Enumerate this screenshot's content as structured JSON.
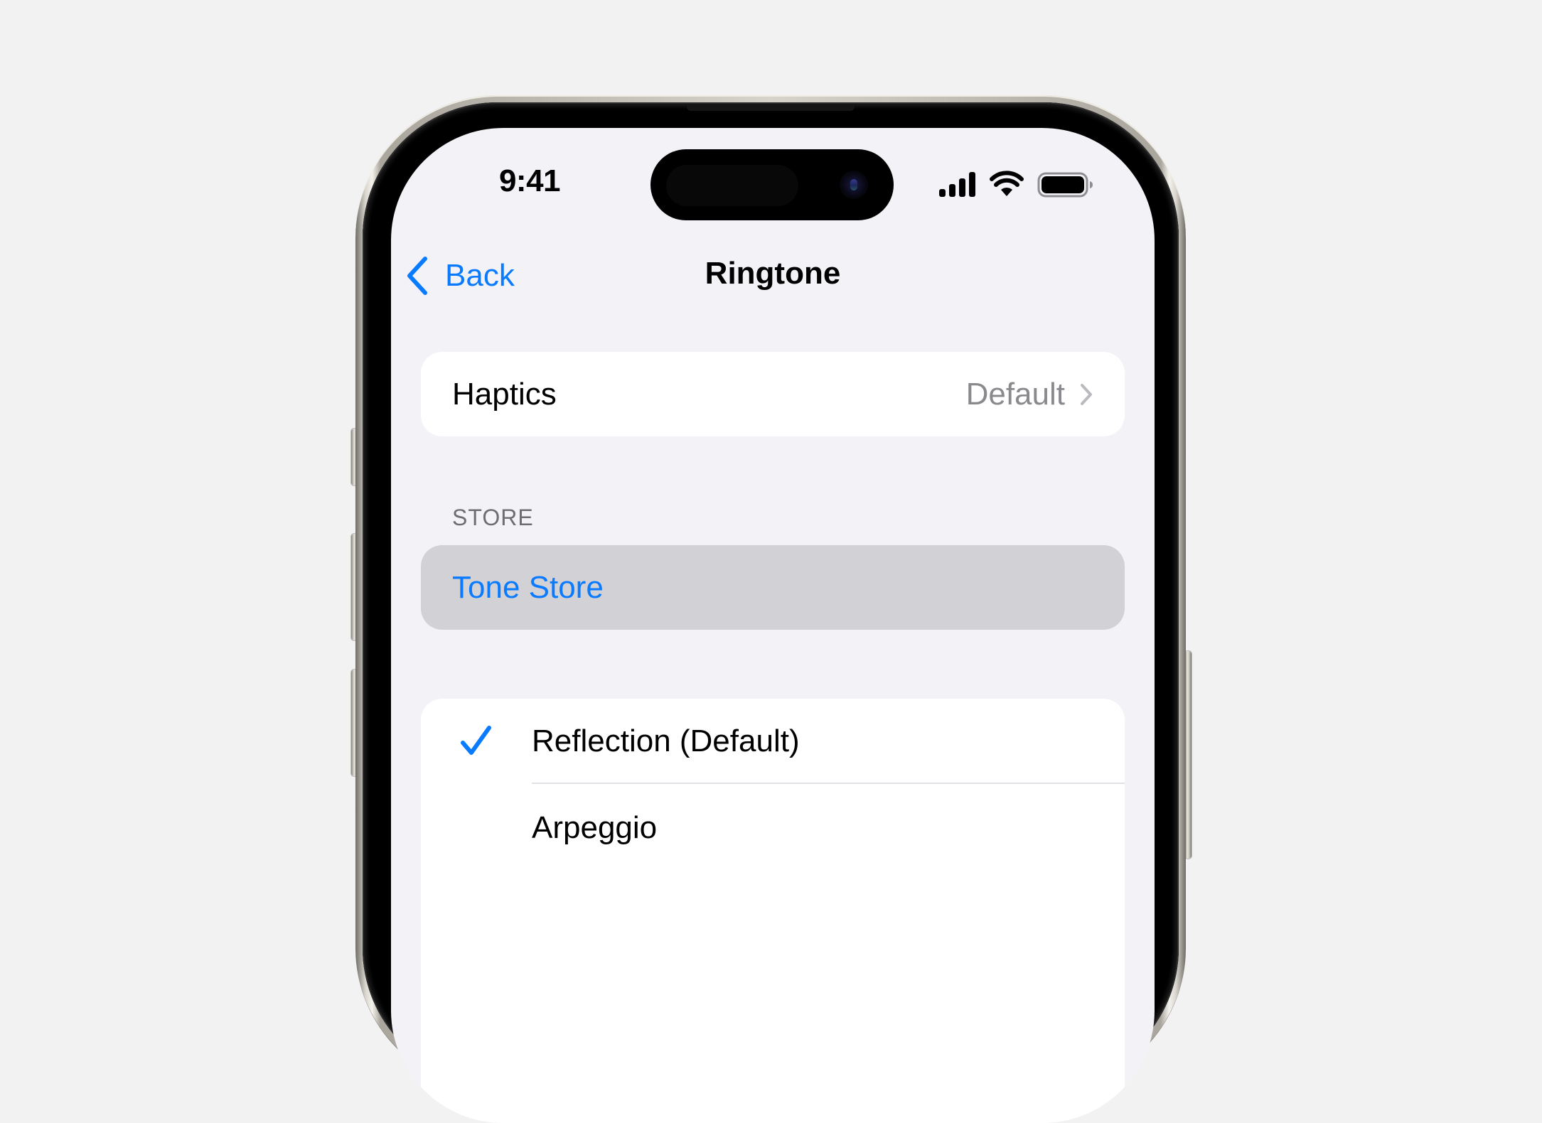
{
  "status_bar": {
    "time": "9:41",
    "icons": [
      "cellular-signal-icon",
      "wifi-icon",
      "battery-icon"
    ]
  },
  "nav": {
    "back_label": "Back",
    "title": "Ringtone"
  },
  "haptics": {
    "label": "Haptics",
    "value": "Default"
  },
  "store_section": {
    "header": "STORE",
    "tone_store_label": "Tone Store"
  },
  "ringtones": {
    "items": [
      {
        "label": "Reflection (Default)",
        "selected": true
      },
      {
        "label": "Arpeggio",
        "selected": false
      }
    ]
  },
  "colors": {
    "accent": "#0a7aff",
    "background": "#f2f2f7",
    "card": "#ffffff",
    "highlighted_row": "#d1d1d6",
    "secondary_text": "#8a8a8e"
  }
}
